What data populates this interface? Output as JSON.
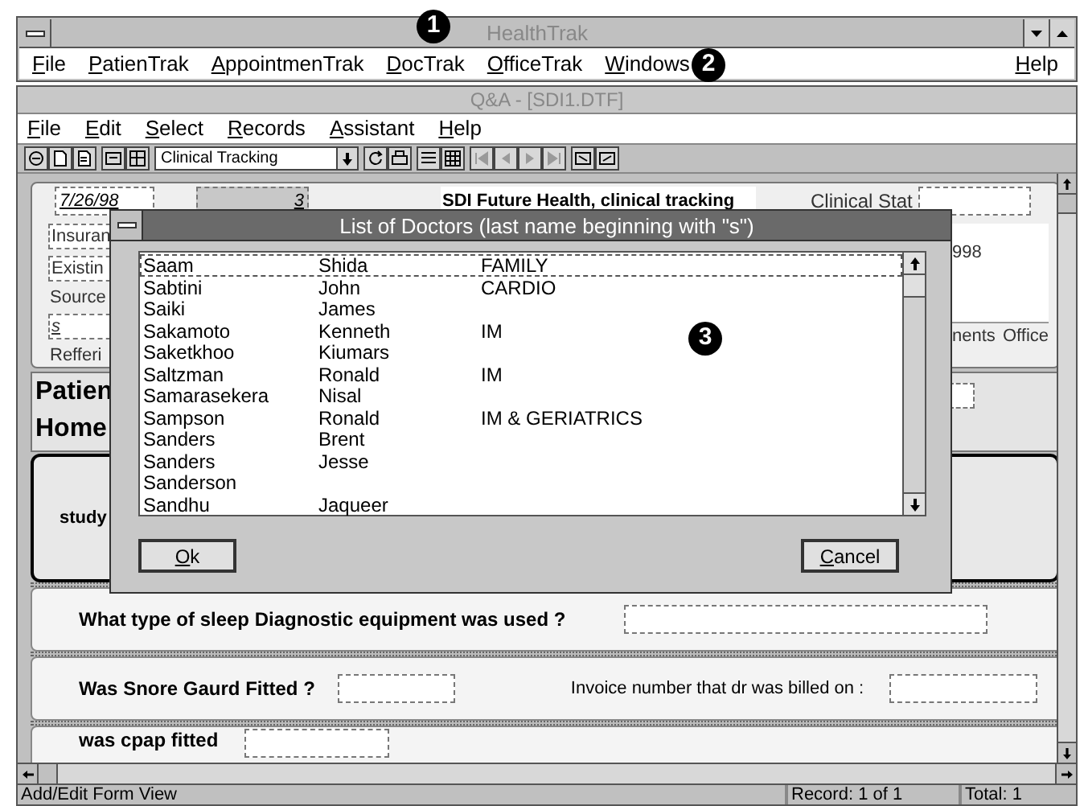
{
  "app_window": {
    "title": "HealthTrak",
    "menu": [
      {
        "label": "File",
        "mnemonic": true
      },
      {
        "label": "PatienTrak",
        "mnemonic": true
      },
      {
        "label": "AppointmenTrak",
        "mnemonic": true
      },
      {
        "label": "DocTrak",
        "mnemonic": true
      },
      {
        "label": "OfficeTrak",
        "mnemonic": true
      },
      {
        "label": "Windows",
        "mnemonic": true
      }
    ],
    "help_menu": {
      "label": "Help",
      "mnemonic": true
    }
  },
  "document_window": {
    "title": "Q&A - [SDI1.DTF]",
    "menu": [
      {
        "label": "File",
        "mnemonic": true
      },
      {
        "label": "Edit",
        "mnemonic": true
      },
      {
        "label": "Select",
        "mnemonic": true
      },
      {
        "label": "Records",
        "mnemonic": true
      },
      {
        "label": "Assistant",
        "mnemonic": true
      },
      {
        "label": "Help",
        "mnemonic": true
      }
    ]
  },
  "toolbar": {
    "view_select": "Clinical Tracking",
    "record_nav_disabled": true
  },
  "form": {
    "date": "7/26/98",
    "number": "3",
    "heading": "SDI Future Health, clinical tracking",
    "clinical_stat_label": "Clinical Stat",
    "left_fields": [
      {
        "kind": "field",
        "text": "Insuran"
      },
      {
        "kind": "field",
        "text": "Existin"
      },
      {
        "kind": "label",
        "text": "Source"
      },
      {
        "kind": "field",
        "text": "s"
      },
      {
        "kind": "label",
        "text": "Refferi"
      }
    ],
    "right_texts": [
      "998",
      "nents",
      "Office"
    ],
    "section_titles": [
      "Patien",
      "Home"
    ],
    "panel_label": "study",
    "questions": [
      {
        "text": "What type of sleep Diagnostic equipment was used ?"
      },
      {
        "text": "Was Snore Gaurd Fitted ?",
        "extra_label": "Invoice number that dr was billed on :"
      },
      {
        "text": "was cpap fitted"
      }
    ]
  },
  "dialog": {
    "title": "List of Doctors (last name beginning with \"s\")",
    "rows": [
      {
        "last_name": "Saam",
        "first_name": "Shida",
        "specialty": "FAMILY",
        "selected": true
      },
      {
        "last_name": "Sabtini",
        "first_name": "John",
        "specialty": "CARDIO",
        "selected": false
      },
      {
        "last_name": "Saiki",
        "first_name": "James",
        "selected": false
      },
      {
        "last_name": "Sakamoto",
        "first_name": "Kenneth",
        "specialty": "IM",
        "selected": false
      },
      {
        "last_name": "Saketkhoo",
        "first_name": "Kiumars",
        "selected": false
      },
      {
        "last_name": "Saltzman",
        "first_name": "Ronald",
        "specialty": "IM",
        "selected": false
      },
      {
        "last_name": "Samarasekera",
        "first_name": "Nisal",
        "selected": false
      },
      {
        "last_name": "Sampson",
        "first_name": "Ronald",
        "specialty": "IM & GERIATRICS",
        "selected": false
      },
      {
        "last_name": "Sanders",
        "first_name": "Brent",
        "selected": false
      },
      {
        "last_name": "Sanders",
        "first_name": "Jesse",
        "selected": false
      },
      {
        "last_name": "Sanderson",
        "selected": false
      },
      {
        "last_name": "Sandhu",
        "first_name": "Jaqueer",
        "selected": false
      }
    ],
    "buttons": [
      {
        "label": "Ok",
        "mnemonic": true
      },
      {
        "label": "Cancel",
        "mnemonic": true
      }
    ]
  },
  "callouts": [
    "1",
    "2",
    "3"
  ],
  "status_bar": {
    "mode": "Add/Edit Form View",
    "record": "Record: 1 of 1",
    "total": "Total: 1"
  }
}
